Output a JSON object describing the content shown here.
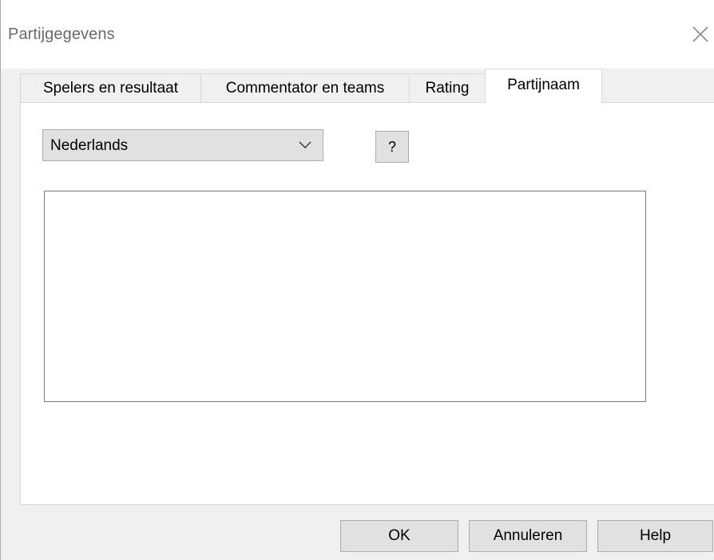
{
  "window": {
    "title": "Partijgegevens"
  },
  "tabs": [
    {
      "label": "Spelers en resultaat",
      "active": false
    },
    {
      "label": "Commentator en teams",
      "active": false
    },
    {
      "label": "Rating",
      "active": false
    },
    {
      "label": "Partijnaam",
      "active": true
    }
  ],
  "language_select": {
    "value": "Nederlands"
  },
  "help_query_button": {
    "label": "?"
  },
  "name_text": {
    "value": ""
  },
  "footer": {
    "ok_label": "OK",
    "cancel_label": "Annuleren",
    "help_label": "Help"
  },
  "icons": {
    "close": "close-icon",
    "dropdown": "chevron-down-icon"
  }
}
